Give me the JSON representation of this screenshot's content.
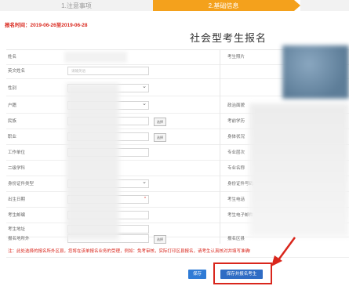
{
  "steps": [
    "1.注意事项",
    "2.基础信息"
  ],
  "period": {
    "label": "报名时间：",
    "value": "2019-06-26至2019-06-28"
  },
  "title": "社会型考生报名",
  "form": {
    "left_labels": [
      "姓名",
      "英文姓名",
      "性别",
      "户籍",
      "民族",
      "职业",
      "工作单位",
      "二级学科",
      "身份证件类型",
      "出生日期",
      "考生邮编",
      "考生地址",
      "报名地所外"
    ],
    "right_labels": [
      "考生照片",
      "政治面貌",
      "考前学历",
      "身体状况",
      "专业层次",
      "专业名称",
      "身份证件号码",
      "考生电话",
      "考生电子邮件",
      "报名区县"
    ],
    "english_name_placeholder": "请输英语",
    "select_button": "选择",
    "required_mark": "*"
  },
  "note": {
    "prefix": "注：",
    "text": "此处选择的报名所外区县，您将在该单报名业务的受理，例如：免考审核，实际打印区县报名，请考生认真核对并填写准确!"
  },
  "buttons": {
    "save": "保存",
    "submit": "保存并报名考生"
  },
  "colors": {
    "accent": "#f4a11c",
    "primary": "#2f6cc4",
    "alert": "#d9261c"
  }
}
